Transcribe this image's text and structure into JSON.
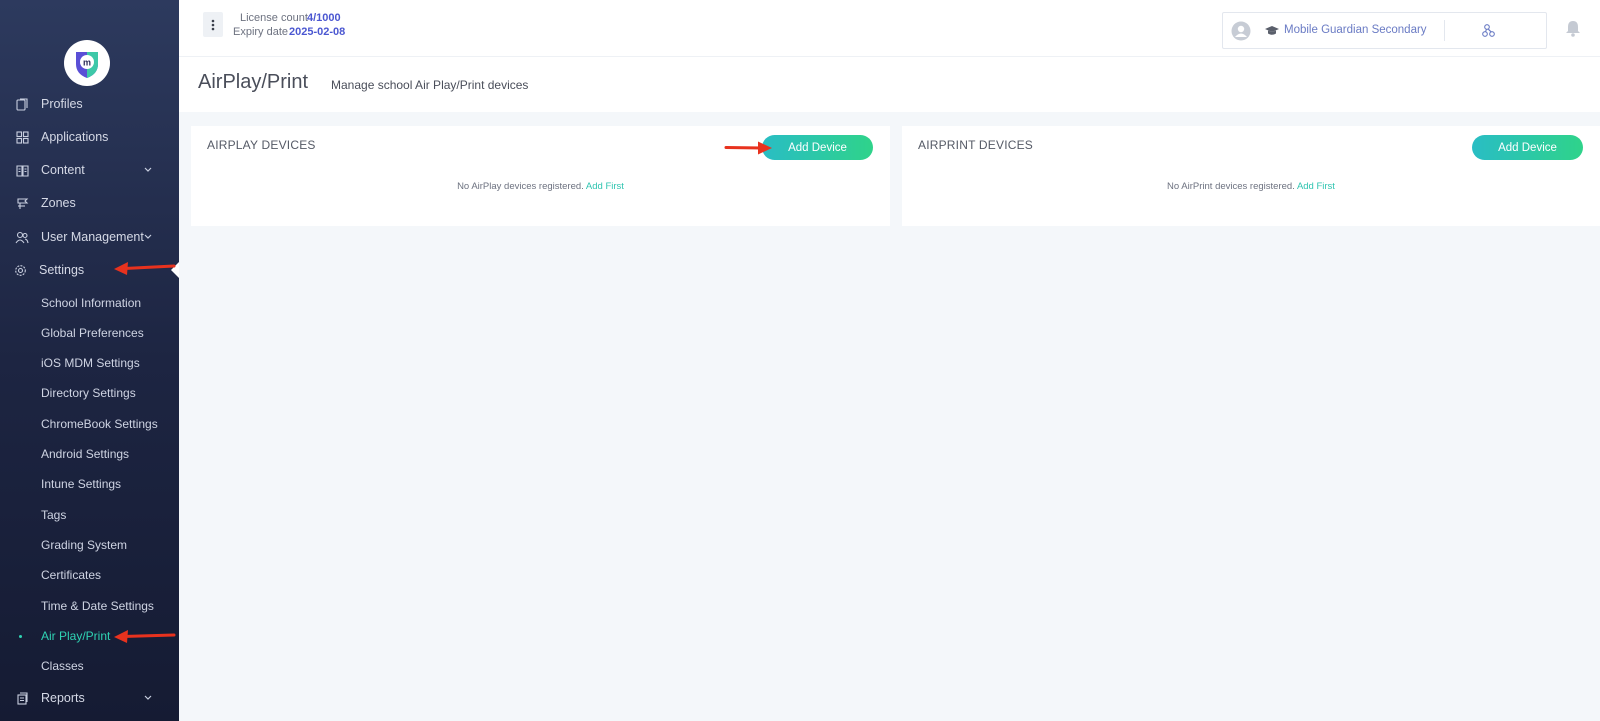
{
  "sidebar": {
    "items": [
      {
        "label": "Profiles"
      },
      {
        "label": "Applications"
      },
      {
        "label": "Content"
      },
      {
        "label": "Zones"
      },
      {
        "label": "User Management"
      },
      {
        "label": "Settings"
      }
    ],
    "settings_sub": [
      {
        "label": "School Information"
      },
      {
        "label": "Global Preferences"
      },
      {
        "label": "iOS MDM Settings"
      },
      {
        "label": "Directory Settings"
      },
      {
        "label": "ChromeBook Settings"
      },
      {
        "label": "Android Settings"
      },
      {
        "label": "Intune Settings"
      },
      {
        "label": "Tags"
      },
      {
        "label": "Grading System"
      },
      {
        "label": "Certificates"
      },
      {
        "label": "Time & Date Settings"
      },
      {
        "label": "Air Play/Print"
      },
      {
        "label": "Classes"
      }
    ],
    "reports_label": "Reports",
    "active_item": "Air Play/Print"
  },
  "header": {
    "license_label": "License count",
    "license_value": "4/1000",
    "expiry_label": "Expiry date",
    "expiry_value": "2025-02-08",
    "school_name": "Mobile Guardian Secondary"
  },
  "page": {
    "title": "AirPlay/Print",
    "subtitle": "Manage school Air Play/Print devices"
  },
  "airplay": {
    "title": "AIRPLAY DEVICES",
    "button": "Add Device",
    "empty_text": "No AirPlay devices registered.",
    "empty_link": "Add First"
  },
  "airprint": {
    "title": "AIRPRINT DEVICES",
    "button": "Add Device",
    "empty_text": "No AirPrint devices registered.",
    "empty_link": "Add First"
  },
  "colors": {
    "accent": "#2fd3b3",
    "button_start": "#29bdc4",
    "button_end": "#2fd38a",
    "link": "#4b57d1",
    "annotation_arrow": "#e8321e"
  }
}
